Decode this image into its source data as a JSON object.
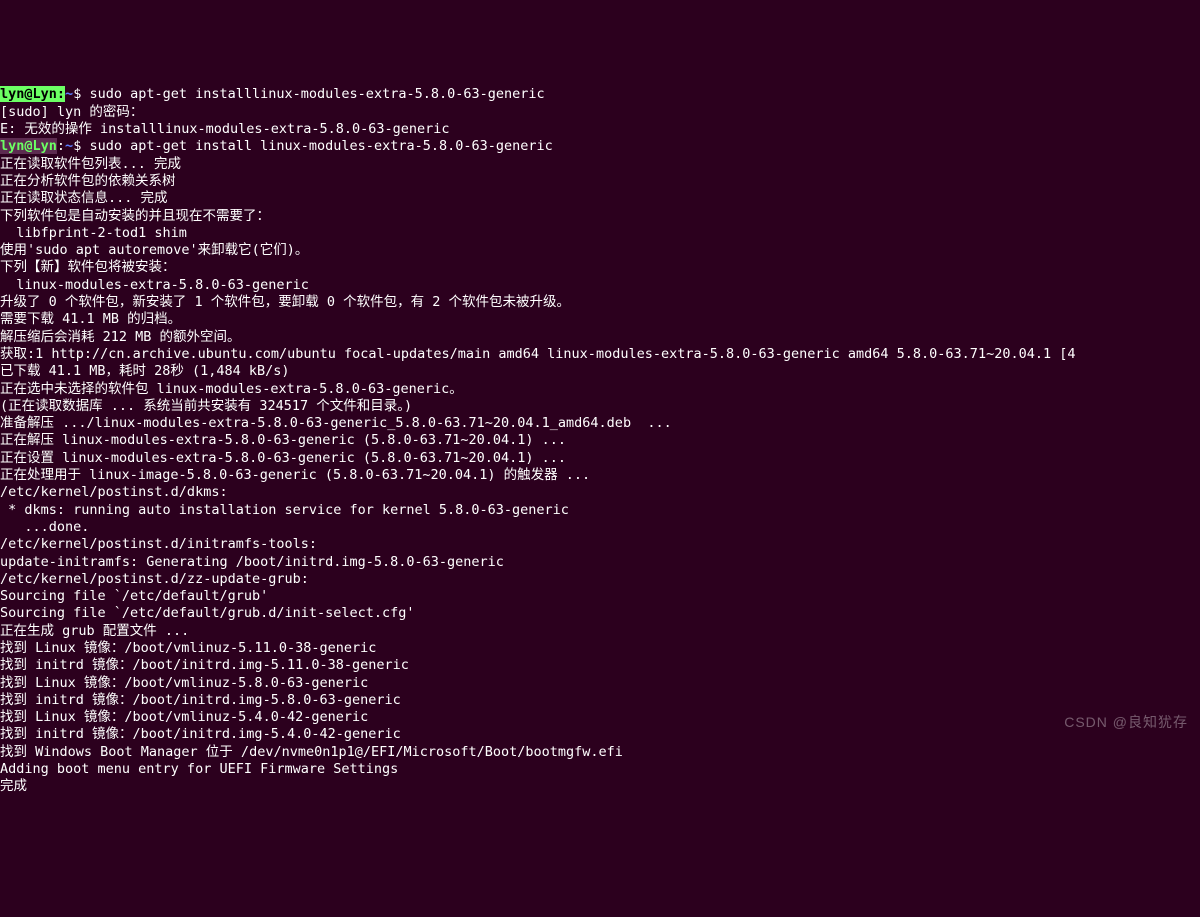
{
  "prompt1": {
    "user": "lyn@Lyn",
    "path": "~",
    "dollar": "$",
    "cmd": "sudo apt-get installlinux-modules-extra-5.8.0-63-generic"
  },
  "line_sudo_pwd": "[sudo] lyn 的密码：",
  "line_invalid": "E: 无效的操作 installlinux-modules-extra-5.8.0-63-generic",
  "prompt2": {
    "user": "lyn@Lyn",
    "path": "~",
    "dollar": "$",
    "cmd": "sudo apt-get install linux-modules-extra-5.8.0-63-generic"
  },
  "l_read_pkg": "正在读取软件包列表... 完成",
  "l_dep_tree": "正在分析软件包的依赖关系树",
  "l_state": "正在读取状态信息... 完成",
  "l_autorm_hdr": "下列软件包是自动安装的并且现在不需要了：",
  "l_autorm_pkg": "  libfprint-2-tod1 shim",
  "l_autorm_tip": "使用'sudo apt autoremove'来卸载它(它们)。",
  "l_new_hdr": "下列【新】软件包将被安装：",
  "l_new_pkg": "  linux-modules-extra-5.8.0-63-generic",
  "l_summary": "升级了 0 个软件包，新安装了 1 个软件包，要卸载 0 个软件包，有 2 个软件包未被升级。",
  "l_need_dl": "需要下载 41.1 MB 的归档。",
  "l_after": "解压缩后会消耗 212 MB 的额外空间。",
  "l_get1": "获取:1 http://cn.archive.ubuntu.com/ubuntu focal-updates/main amd64 linux-modules-extra-5.8.0-63-generic amd64 5.8.0-63.71~20.04.1 [4",
  "l_fetched": "已下载 41.1 MB，耗时 28秒 (1,484 kB/s)",
  "l_select": "正在选中未选择的软件包 linux-modules-extra-5.8.0-63-generic。",
  "l_readdb": "(正在读取数据库 ... 系统当前共安装有 324517 个文件和目录。)",
  "l_prepare": "准备解压 .../linux-modules-extra-5.8.0-63-generic_5.8.0-63.71~20.04.1_amd64.deb  ...",
  "l_unpack": "正在解压 linux-modules-extra-5.8.0-63-generic (5.8.0-63.71~20.04.1) ...",
  "l_setup": "正在设置 linux-modules-extra-5.8.0-63-generic (5.8.0-63.71~20.04.1) ...",
  "l_trig": "正在处理用于 linux-image-5.8.0-63-generic (5.8.0-63.71~20.04.1) 的触发器 ...",
  "l_dkms_hdr": "/etc/kernel/postinst.d/dkms:",
  "l_dkms_run": " * dkms: running auto installation service for kernel 5.8.0-63-generic",
  "l_dkms_done": "   ...done.",
  "l_initram_hdr": "/etc/kernel/postinst.d/initramfs-tools:",
  "l_initram_gen": "update-initramfs: Generating /boot/initrd.img-5.8.0-63-generic",
  "l_grub_hdr": "/etc/kernel/postinst.d/zz-update-grub:",
  "l_src1": "Sourcing file `/etc/default/grub'",
  "l_src2": "Sourcing file `/etc/default/grub.d/init-select.cfg'",
  "l_grub_gen": "正在生成 grub 配置文件 ...",
  "l_find1": "找到 Linux 镜像：/boot/vmlinuz-5.11.0-38-generic",
  "l_find2": "找到 initrd 镜像：/boot/initrd.img-5.11.0-38-generic",
  "l_find3": "找到 Linux 镜像：/boot/vmlinuz-5.8.0-63-generic",
  "l_find4": "找到 initrd 镜像：/boot/initrd.img-5.8.0-63-generic",
  "l_find5": "找到 Linux 镜像：/boot/vmlinuz-5.4.0-42-generic",
  "l_find6": "找到 initrd 镜像：/boot/initrd.img-5.4.0-42-generic",
  "l_find_win": "找到 Windows Boot Manager 位于 /dev/nvme0n1p1@/EFI/Microsoft/Boot/bootmgfw.efi",
  "l_uefi": "Adding boot menu entry for UEFI Firmware Settings",
  "l_done": "完成",
  "watermark": "CSDN @良知犹存"
}
